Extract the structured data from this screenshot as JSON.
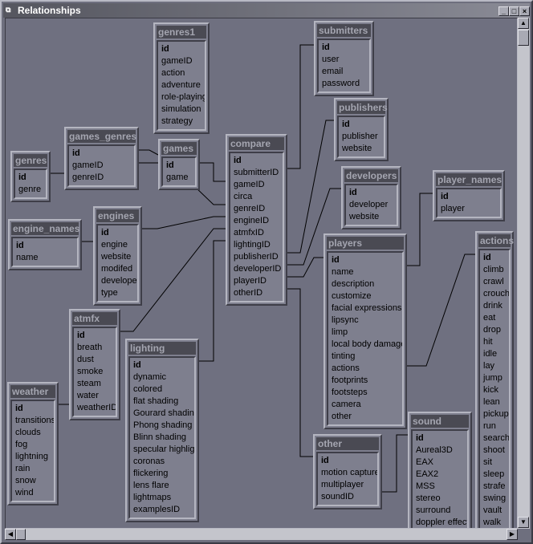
{
  "window": {
    "title": "Relationships",
    "minimize": "_",
    "maximize": "□",
    "close": "×"
  },
  "colors": {
    "canvas": "#6f7080",
    "table_body": "#7e7f8e",
    "table_header": "#4a4a53",
    "header_text": "#a4a5b0"
  },
  "tables": {
    "genres1": {
      "name": "genres1",
      "fields": [
        "id",
        "gameID",
        "action",
        "adventure",
        "role-playing",
        "simulation",
        "strategy"
      ]
    },
    "submitters": {
      "name": "submitters",
      "fields": [
        "id",
        "user",
        "email",
        "password"
      ]
    },
    "publishers": {
      "name": "publishers",
      "fields": [
        "id",
        "publisher",
        "website"
      ]
    },
    "developers": {
      "name": "developers",
      "fields": [
        "id",
        "developer",
        "website"
      ]
    },
    "player_names": {
      "name": "player_names",
      "fields": [
        "id",
        "player"
      ]
    },
    "games_genres": {
      "name": "games_genres",
      "fields": [
        "id",
        "gameID",
        "genreID"
      ]
    },
    "games": {
      "name": "games",
      "fields": [
        "id",
        "game"
      ]
    },
    "genres": {
      "name": "genres",
      "fields": [
        "id",
        "genre"
      ]
    },
    "compare": {
      "name": "compare",
      "fields": [
        "id",
        "submitterID",
        "gameID",
        "circa",
        "genreID",
        "engineID",
        "atmfxID",
        "lightingID",
        "publisherID",
        "developerID",
        "playerID",
        "otherID"
      ]
    },
    "engine_names": {
      "name": "engine_names",
      "fields": [
        "id",
        "name"
      ]
    },
    "engines": {
      "name": "engines",
      "fields": [
        "id",
        "engine",
        "website",
        "modifed",
        "developer",
        "type"
      ]
    },
    "players": {
      "name": "players",
      "fields": [
        "id",
        "name",
        "description",
        "customize",
        "facial expressions",
        "lipsync",
        "limp",
        "local body damage",
        "tinting",
        "actions",
        "footprints",
        "footsteps",
        "camera",
        "other"
      ]
    },
    "actions": {
      "name": "actions",
      "fields": [
        "id",
        "climb",
        "crawl",
        "crouch",
        "drink",
        "eat",
        "drop",
        "hit",
        "idle",
        "lay",
        "jump",
        "kick",
        "lean",
        "pickup",
        "run",
        "search",
        "shoot",
        "sit",
        "sleep",
        "strafe",
        "swing",
        "vault",
        "walk"
      ]
    },
    "atmfx": {
      "name": "atmfx",
      "fields": [
        "id",
        "breath",
        "dust",
        "smoke",
        "steam",
        "water",
        "weatherID"
      ]
    },
    "lighting": {
      "name": "lighting",
      "fields": [
        "id",
        "dynamic",
        "colored",
        "flat shading",
        "Gourard shading",
        "Phong shading",
        "Blinn shading",
        "specular highlight",
        "coronas",
        "flickering",
        "lens flare",
        "lightmaps",
        "examplesID"
      ]
    },
    "weather": {
      "name": "weather",
      "fields": [
        "id",
        "transitions",
        "clouds",
        "fog",
        "lightning",
        "rain",
        "snow",
        "wind"
      ]
    },
    "other": {
      "name": "other",
      "fields": [
        "id",
        "motion capture",
        "multiplayer",
        "soundID"
      ]
    },
    "sound": {
      "name": "sound",
      "fields": [
        "id",
        "Aureal3D",
        "EAX",
        "EAX2",
        "MSS",
        "stereo",
        "surround",
        "doppler effect"
      ]
    }
  }
}
